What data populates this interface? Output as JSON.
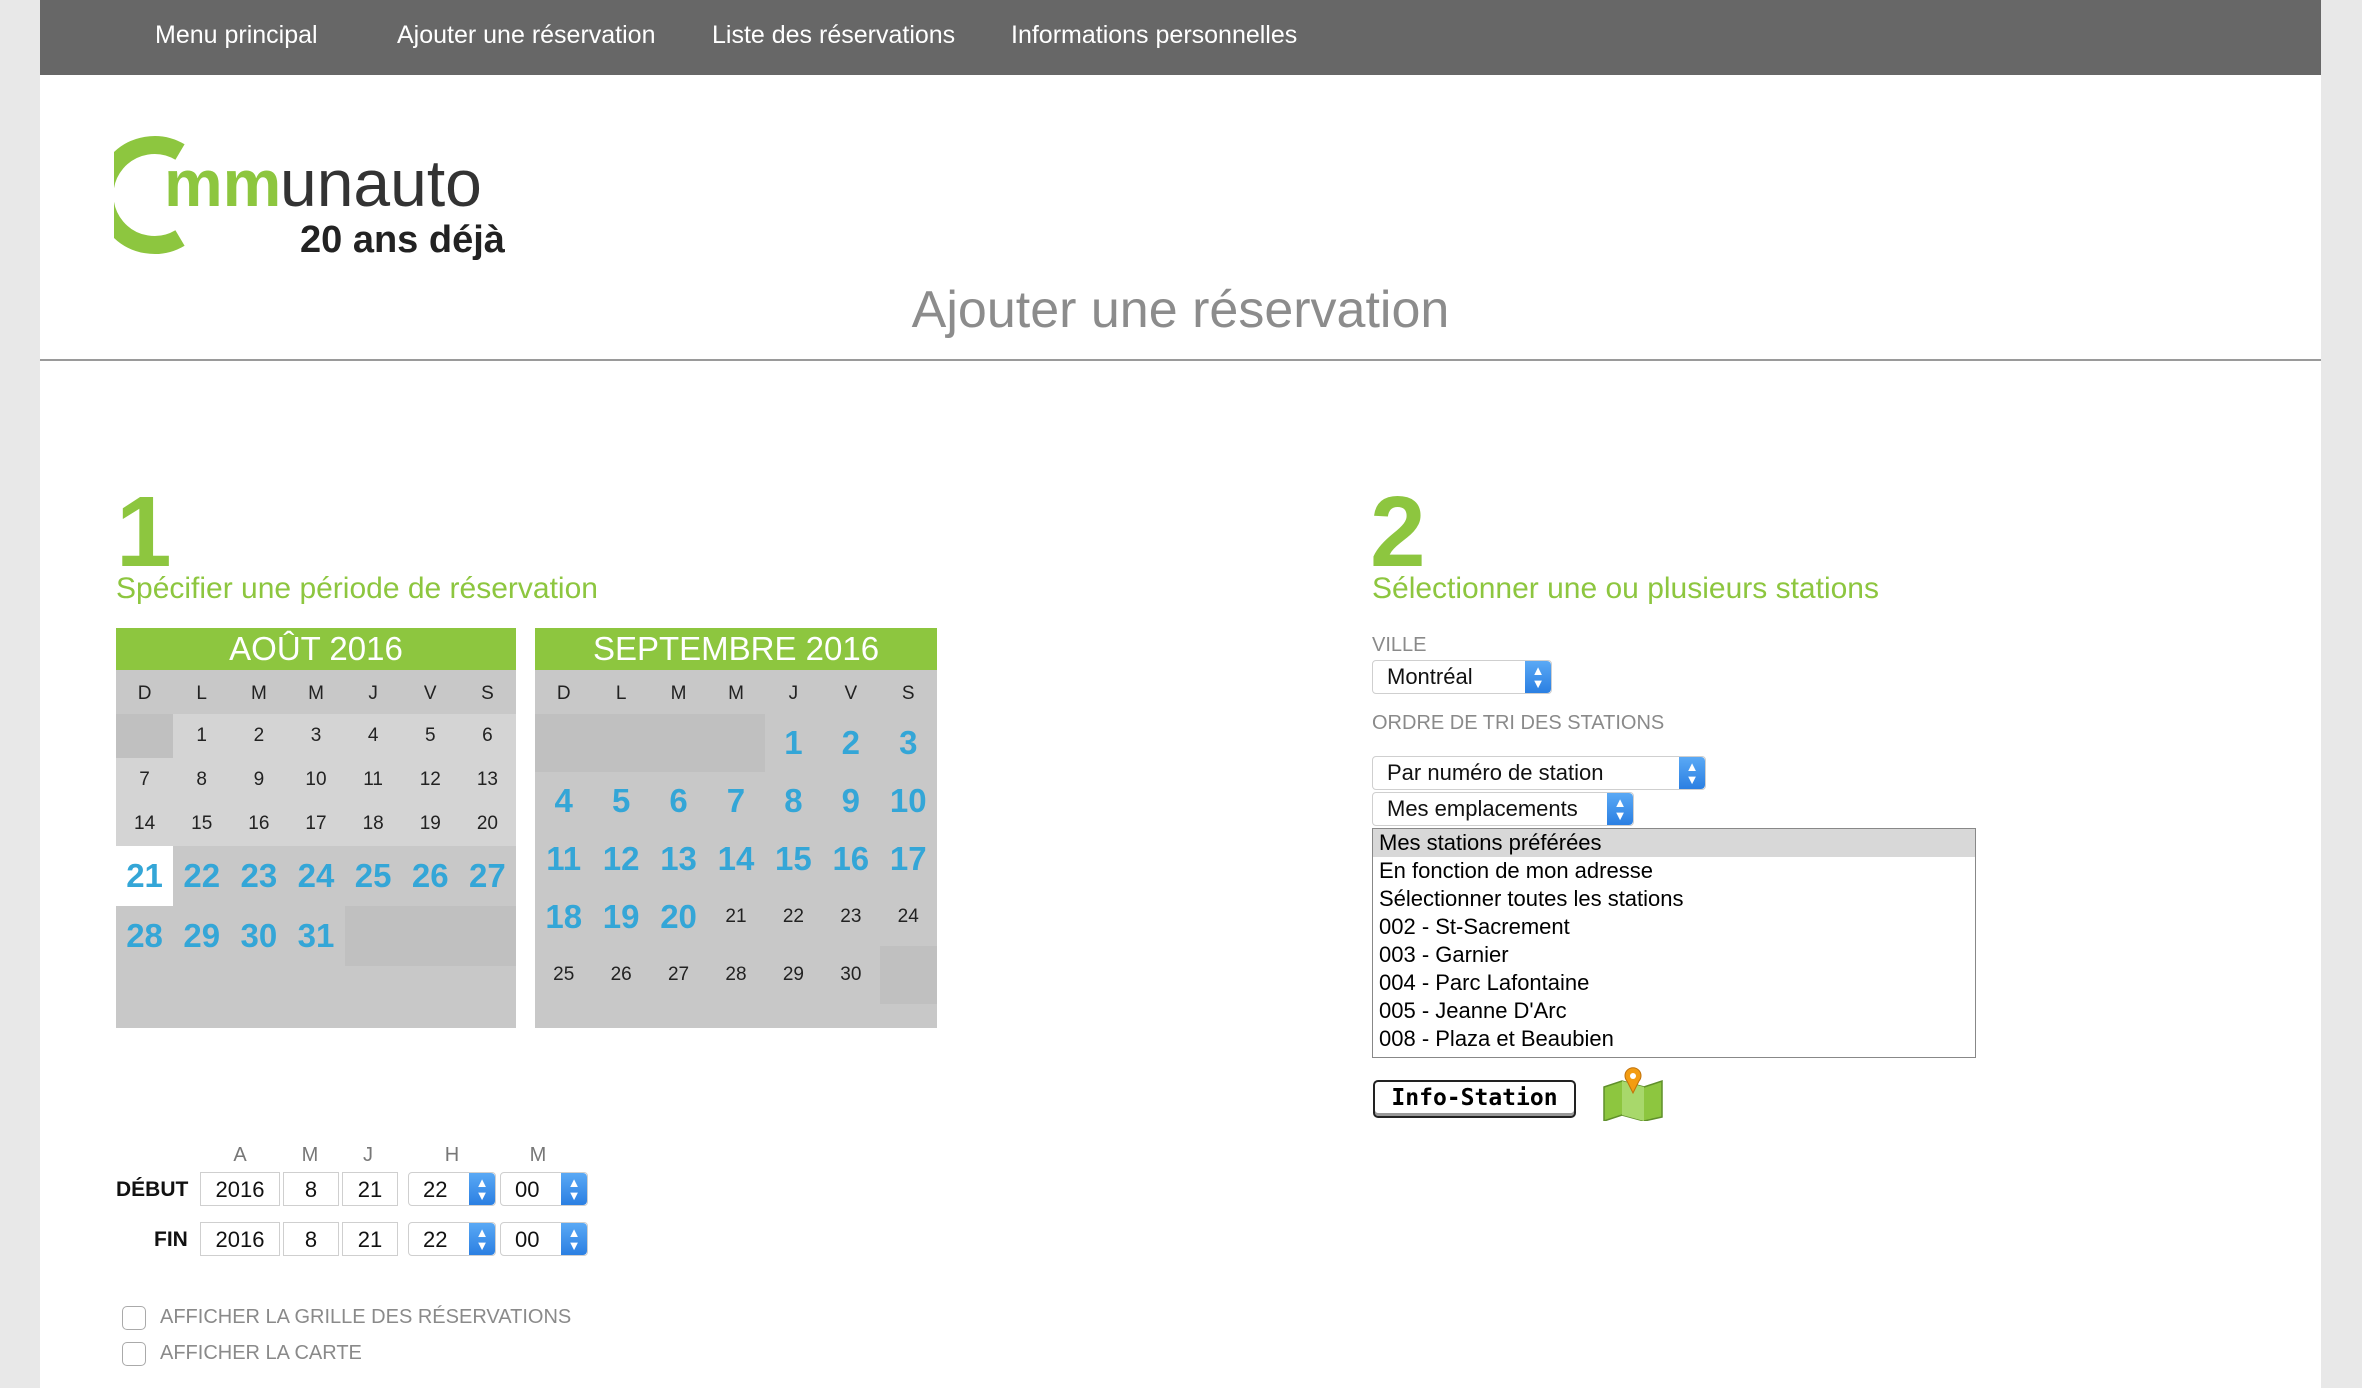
{
  "nav": {
    "items": [
      {
        "label": "Menu principal"
      },
      {
        "label": "Ajouter une réservation"
      },
      {
        "label": "Liste des réservations"
      },
      {
        "label": "Informations personnelles"
      }
    ]
  },
  "logo": {
    "brand": "Communauto",
    "tagline": "20 ans déjà !"
  },
  "page_title": "Ajouter une réservation",
  "step1": {
    "number": "1",
    "heading": "Spécifier une période de réservation",
    "calendars": [
      {
        "title": "AOÛT 2016",
        "dow": [
          "D",
          "L",
          "M",
          "M",
          "J",
          "V",
          "S"
        ],
        "weeks": [
          [
            "",
            "1",
            "2",
            "3",
            "4",
            "5",
            "6"
          ],
          [
            "7",
            "8",
            "9",
            "10",
            "11",
            "12",
            "13"
          ],
          [
            "14",
            "15",
            "16",
            "17",
            "18",
            "19",
            "20"
          ],
          [
            "21",
            "22",
            "23",
            "24",
            "25",
            "26",
            "27"
          ],
          [
            "28",
            "29",
            "30",
            "31",
            "",
            "",
            ""
          ]
        ]
      },
      {
        "title": "SEPTEMBRE 2016",
        "dow": [
          "D",
          "L",
          "M",
          "M",
          "J",
          "V",
          "S"
        ],
        "weeks": [
          [
            "",
            "",
            "",
            "",
            "1",
            "2",
            "3"
          ],
          [
            "4",
            "5",
            "6",
            "7",
            "8",
            "9",
            "10"
          ],
          [
            "11",
            "12",
            "13",
            "14",
            "15",
            "16",
            "17"
          ],
          [
            "18",
            "19",
            "20",
            "21",
            "22",
            "23",
            "24"
          ],
          [
            "25",
            "26",
            "27",
            "28",
            "29",
            "30",
            ""
          ]
        ]
      }
    ],
    "datetime": {
      "col_labels": [
        "A",
        "M",
        "J",
        "H",
        "M"
      ],
      "start_label": "DÉBUT",
      "end_label": "FIN",
      "start": {
        "year": "2016",
        "month": "8",
        "day": "21",
        "hour": "22",
        "minute": "00"
      },
      "end": {
        "year": "2016",
        "month": "8",
        "day": "21",
        "hour": "22",
        "minute": "00"
      }
    },
    "options": [
      {
        "label": "AFFICHER LA GRILLE DES RÉSERVATIONS",
        "checked": false
      },
      {
        "label": "AFFICHER LA CARTE",
        "checked": false
      }
    ]
  },
  "step2": {
    "number": "2",
    "heading": "Sélectionner une ou plusieurs stations",
    "city_label": "VILLE",
    "city_value": "Montréal",
    "sort_label": "ORDRE DE TRI DES STATIONS",
    "sort_value": "Par numéro de station",
    "location_value": "Mes emplacements",
    "stations": [
      "Mes stations préférées",
      "En fonction de mon adresse",
      "Sélectionner toutes les stations",
      "002 - St-Sacrement",
      "003 - Garnier",
      "004 - Parc Lafontaine",
      "005 - Jeanne D'Arc",
      "008 - Plaza et Beaubien"
    ],
    "info_button": "Info-Station",
    "map_icon": "map-pin-icon"
  },
  "colors": {
    "accent_green": "#8dc63f",
    "available_blue": "#34a6d7",
    "nav_bg": "#676767"
  }
}
